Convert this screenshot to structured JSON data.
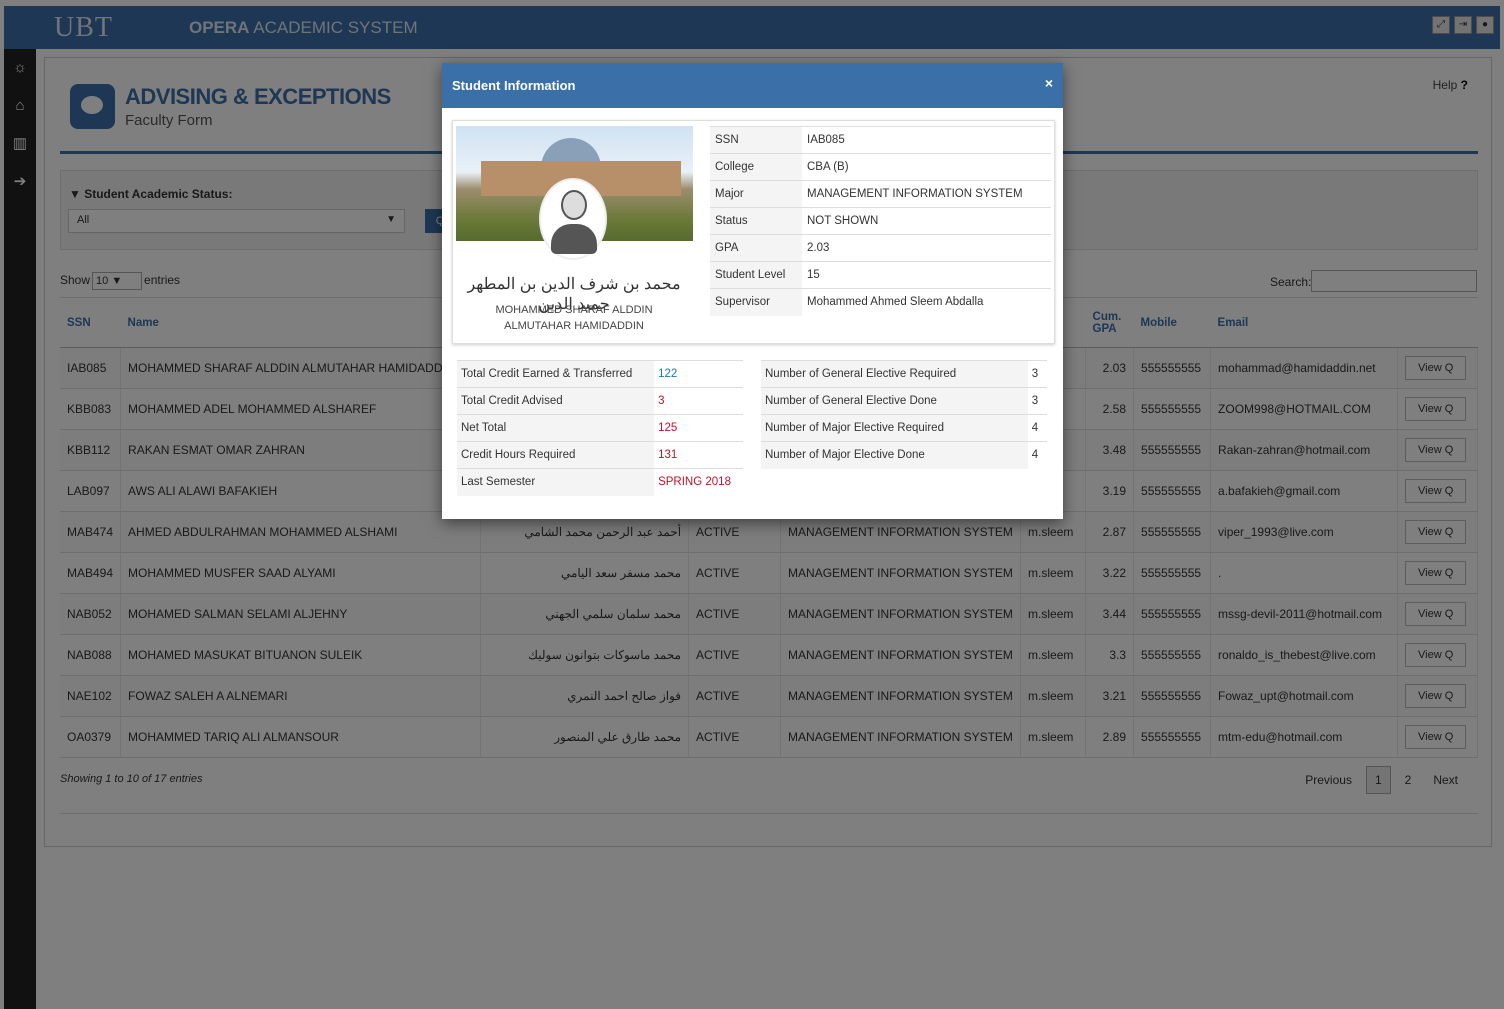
{
  "topbar": {
    "logo": "UBT",
    "system_name_bold": "OPERA",
    "system_name_rest": " ACADEMIC SYSTEM"
  },
  "page": {
    "title": "ADVISING & EXCEPTIONS",
    "subtitle": "Faculty Form",
    "help": "Help",
    "help_mark": "?"
  },
  "filter": {
    "label": "Student Academic Status:",
    "value": "All",
    "search_button": "Q"
  },
  "table_controls": {
    "show": "Show",
    "entries_value": "10",
    "entries": "entries",
    "search": "Search:"
  },
  "table": {
    "headers": {
      "ssn": "SSN",
      "name": "Name",
      "cum_gpa": "Cum. GPA",
      "mobile": "Mobile",
      "email": "Email"
    },
    "view_label": "View Q",
    "rows": [
      {
        "ssn": "IAB085",
        "name": "MOHAMMED SHARAF ALDDIN ALMUTAHAR HAMIDADDIN",
        "ar": "",
        "status": "",
        "major": "",
        "sup": "",
        "gpa": "2.03",
        "mobile": "555555555",
        "email": "mohammad@hamidaddin.net"
      },
      {
        "ssn": "KBB083",
        "name": "MOHAMMED ADEL MOHAMMED ALSHAREF",
        "ar": "",
        "status": "",
        "major": "",
        "sup": "",
        "gpa": "2.58",
        "mobile": "555555555",
        "email": "ZOOM998@HOTMAIL.COM"
      },
      {
        "ssn": "KBB112",
        "name": "RAKAN ESMAT OMAR ZAHRAN",
        "ar": "",
        "status": "",
        "major": "",
        "sup": "",
        "gpa": "3.48",
        "mobile": "555555555",
        "email": "Rakan-zahran@hotmail.com"
      },
      {
        "ssn": "LAB097",
        "name": "AWS ALI ALAWI BAFAKIEH",
        "ar": "",
        "status": "",
        "major": "",
        "sup": "",
        "gpa": "3.19",
        "mobile": "555555555",
        "email": "a.bafakieh@gmail.com"
      },
      {
        "ssn": "MAB474",
        "name": "AHMED ABDULRAHMAN MOHAMMED ALSHAMI",
        "ar": "أحمد عبد الرحمن محمد الشامي",
        "status": "ACTIVE",
        "major": "MANAGEMENT INFORMATION SYSTEM",
        "sup": "m.sleem",
        "gpa": "2.87",
        "mobile": "555555555",
        "email": "viper_1993@live.com"
      },
      {
        "ssn": "MAB494",
        "name": "MOHAMMED MUSFER SAAD ALYAMI",
        "ar": "محمد مسفر سعد اليامي",
        "status": "ACTIVE",
        "major": "MANAGEMENT INFORMATION SYSTEM",
        "sup": "m.sleem",
        "gpa": "3.22",
        "mobile": "555555555",
        "email": "."
      },
      {
        "ssn": "NAB052",
        "name": "MOHAMED SALMAN SELAMI ALJEHNY",
        "ar": "محمد سلمان سلمي الجهني",
        "status": "ACTIVE",
        "major": "MANAGEMENT INFORMATION SYSTEM",
        "sup": "m.sleem",
        "gpa": "3.44",
        "mobile": "555555555",
        "email": "mssg-devil-2011@hotmail.com"
      },
      {
        "ssn": "NAB088",
        "name": "MOHAMED MASUKAT BITUANON SULEIK",
        "ar": "محمد ماسوكات بتوانون سوليك",
        "status": "ACTIVE",
        "major": "MANAGEMENT INFORMATION SYSTEM",
        "sup": "m.sleem",
        "gpa": "3.3",
        "mobile": "555555555",
        "email": "ronaldo_is_thebest@live.com"
      },
      {
        "ssn": "NAE102",
        "name": "FOWAZ SALEH A ALNEMARI",
        "ar": "فواز صالح احمد النمري",
        "status": "ACTIVE",
        "major": "MANAGEMENT INFORMATION SYSTEM",
        "sup": "m.sleem",
        "gpa": "3.21",
        "mobile": "555555555",
        "email": "Fowaz_upt@hotmail.com"
      },
      {
        "ssn": "OA0379",
        "name": "MOHAMMED TARIQ ALI ALMANSOUR",
        "ar": "محمد طارق علي المنصور",
        "status": "ACTIVE",
        "major": "MANAGEMENT INFORMATION SYSTEM",
        "sup": "m.sleem",
        "gpa": "2.89",
        "mobile": "555555555",
        "email": "mtm-edu@hotmail.com"
      }
    ]
  },
  "footer": {
    "showing": "Showing 1 to 10 of 17 entries",
    "previous": "Previous",
    "page1": "1",
    "page2": "2",
    "next": "Next"
  },
  "modal": {
    "title": "Student Information",
    "close": "×",
    "name_ar": "محمد بن شرف الدين بن المطهر حميد الدين",
    "name_en": "MOHAMMED SHARAF ALDDIN ALMUTAHAR HAMIDADDIN",
    "info": [
      {
        "k": "SSN",
        "v": "IAB085"
      },
      {
        "k": "College",
        "v": "CBA (B)"
      },
      {
        "k": "Major",
        "v": "MANAGEMENT INFORMATION SYSTEM"
      },
      {
        "k": "Status",
        "v": "NOT SHOWN"
      },
      {
        "k": "GPA",
        "v": "2.03"
      },
      {
        "k": "Student Level",
        "v": "15"
      },
      {
        "k": "Supervisor",
        "v": "Mohammed Ahmed Sleem Abdalla"
      }
    ],
    "stats_left": [
      {
        "k": "Total Credit Earned & Transferred",
        "v": "122"
      },
      {
        "k": "Total Credit Advised",
        "v": "3"
      },
      {
        "k": "Net Total",
        "v": "125"
      },
      {
        "k": "Credit Hours Required",
        "v": "131"
      },
      {
        "k": "Last Semester",
        "v": "SPRING 2018"
      }
    ],
    "stats_right": [
      {
        "k": "Number of General Elective Required",
        "v": "3"
      },
      {
        "k": "Number of General Elective Done",
        "v": "3"
      },
      {
        "k": "Number of Major Elective Required",
        "v": "4"
      },
      {
        "k": "Number of Major Elective Done",
        "v": "4"
      }
    ]
  }
}
